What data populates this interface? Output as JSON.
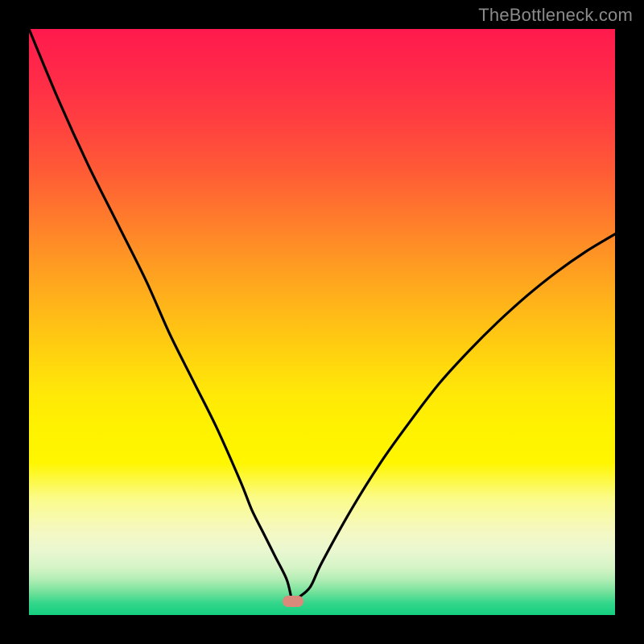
{
  "watermark": "TheBottleneck.com",
  "colors": {
    "frame": "#000000",
    "marker": "#d98a7a",
    "curve": "#000000",
    "gradient_top": "#ff1a4d",
    "gradient_bottom": "#14cf80"
  },
  "chart_data": {
    "type": "line",
    "title": "",
    "xlabel": "",
    "ylabel": "",
    "xlim": [
      0,
      100
    ],
    "ylim": [
      0,
      100
    ],
    "grid": false,
    "legend": false,
    "marker": {
      "x_percent": 45,
      "y_from_top_percent": 97.7
    },
    "series": [
      {
        "name": "bottleneck-curve",
        "x_percent": [
          0,
          5,
          10,
          15,
          20,
          24,
          28,
          32,
          36,
          38,
          40,
          42,
          44,
          45,
          46,
          48,
          50,
          55,
          60,
          65,
          70,
          75,
          80,
          85,
          90,
          95,
          100
        ],
        "y_from_top_percent": [
          0,
          12,
          23,
          33,
          43,
          52,
          60,
          68,
          77,
          82,
          86,
          90,
          94,
          97.7,
          97,
          95.2,
          91,
          82,
          74,
          67,
          60.5,
          55,
          50,
          45.5,
          41.5,
          38,
          35
        ],
        "note": "y measured from top; minimum (closest to bottom) at x≈45%"
      }
    ],
    "background": {
      "type": "vertical-gradient",
      "meaning": "red-top (high bottleneck) to green-bottom (low bottleneck)"
    }
  }
}
